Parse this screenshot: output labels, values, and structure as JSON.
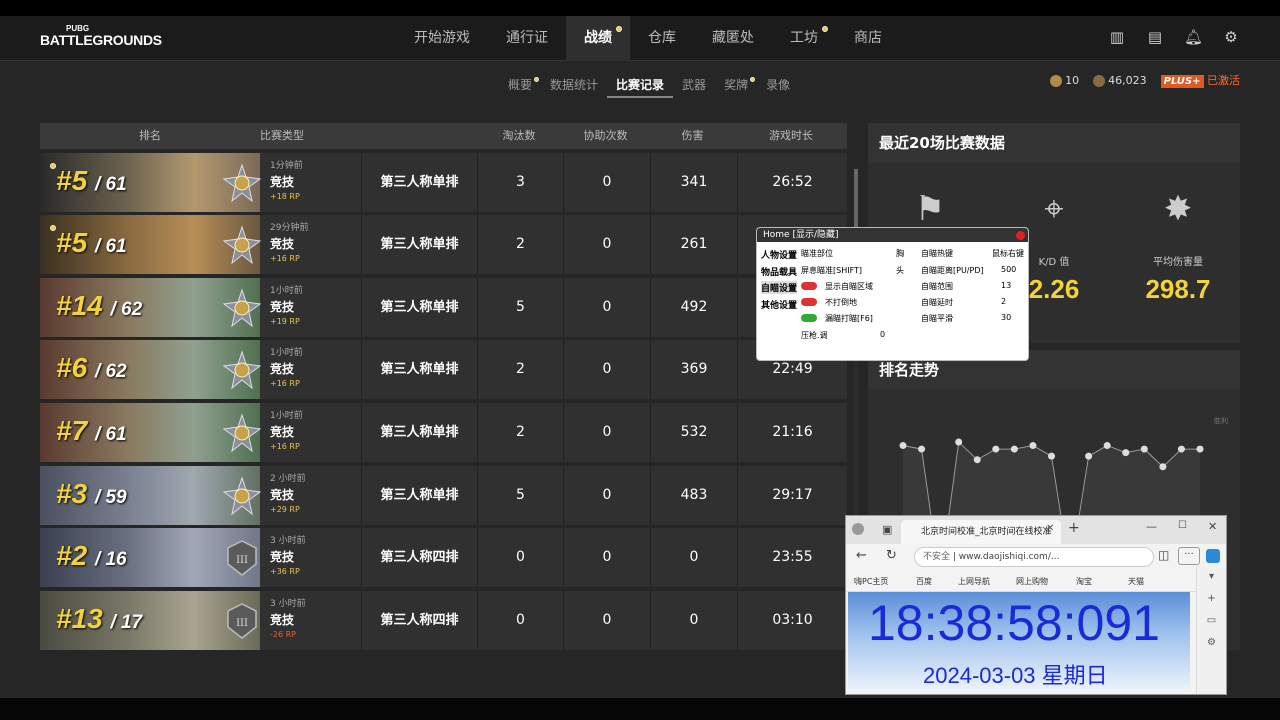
{
  "topbar": {
    "logo_small": "PUBG",
    "logo_big": "BATTLEGROUNDS",
    "nav": [
      {
        "label": "开始游戏",
        "active": false
      },
      {
        "label": "通行证",
        "active": false
      },
      {
        "label": "战绩",
        "active": true
      },
      {
        "label": "仓库",
        "active": false
      },
      {
        "label": "藏匿处",
        "active": false
      },
      {
        "label": "工坊",
        "active": false
      },
      {
        "label": "商店",
        "active": false
      }
    ]
  },
  "subnav": [
    {
      "label": "概要"
    },
    {
      "label": "数据统计"
    },
    {
      "label": "比赛记录"
    },
    {
      "label": "武器"
    },
    {
      "label": "奖牌"
    },
    {
      "label": "录像"
    }
  ],
  "currency": {
    "g_coin": "10",
    "bp": "46,023",
    "plus": "PLUS+",
    "status": "已激活"
  },
  "table": {
    "headers": {
      "rank": "排名",
      "type": "比赛类型",
      "kills": "淘汰数",
      "assists": "协助次数",
      "damage": "伤害",
      "time": "游戏时长"
    },
    "rows": [
      {
        "rank": "#5",
        "total": "/ 61",
        "ago": "1分钟前",
        "mode": "竞技",
        "rp": "+18 RP",
        "type": "第三人称单排",
        "kills": "3",
        "assists": "0",
        "damage": "341",
        "time": "26:52"
      },
      {
        "rank": "#5",
        "total": "/ 61",
        "ago": "29分钟前",
        "mode": "竞技",
        "rp": "+16 RP",
        "type": "第三人称单排",
        "kills": "2",
        "assists": "0",
        "damage": "261",
        "time": ""
      },
      {
        "rank": "#14",
        "total": "/ 62",
        "ago": "1小时前",
        "mode": "竞技",
        "rp": "+19 RP",
        "type": "第三人称单排",
        "kills": "5",
        "assists": "0",
        "damage": "492",
        "time": ""
      },
      {
        "rank": "#6",
        "total": "/ 62",
        "ago": "1小时前",
        "mode": "竞技",
        "rp": "+16 RP",
        "type": "第三人称单排",
        "kills": "2",
        "assists": "0",
        "damage": "369",
        "time": "22:49"
      },
      {
        "rank": "#7",
        "total": "/ 61",
        "ago": "1小时前",
        "mode": "竞技",
        "rp": "+16 RP",
        "type": "第三人称单排",
        "kills": "2",
        "assists": "0",
        "damage": "532",
        "time": "21:16"
      },
      {
        "rank": "#3",
        "total": "/ 59",
        "ago": "2 小时前",
        "mode": "竞技",
        "rp": "+29 RP",
        "type": "第三人称单排",
        "kills": "5",
        "assists": "0",
        "damage": "483",
        "time": "29:17"
      },
      {
        "rank": "#2",
        "total": "/ 16",
        "ago": "3 小时前",
        "mode": "竞技",
        "rp": "+36 RP",
        "type": "第三人称四排",
        "kills": "0",
        "assists": "0",
        "damage": "0",
        "time": "23:55"
      },
      {
        "rank": "#13",
        "total": "/ 17",
        "ago": "3 小时前",
        "mode": "竞技",
        "rp": "-26 RP",
        "type": "第三人称四排",
        "kills": "0",
        "assists": "0",
        "damage": "0",
        "time": "03:10"
      }
    ]
  },
  "stats_panel": {
    "title": "最近20场比赛数据",
    "kd_label": "K/D 值",
    "kd_value": "2.26",
    "dmg_label": "平均伤害量",
    "dmg_value": "298.7"
  },
  "trend_panel": {
    "title": "排名走势",
    "side_label": "胜利"
  },
  "chart_data": {
    "type": "line",
    "title": "排名走势",
    "values": [
      2,
      3,
      40,
      1,
      6,
      3,
      3,
      2,
      5,
      38,
      5,
      2,
      4,
      3,
      8,
      3,
      3
    ]
  },
  "overlay": {
    "title": "Home [显示/隐藏]",
    "col1": [
      "人物设置",
      "物品载具",
      "自瞄设置",
      "其他设置"
    ],
    "col2": [
      "瞄准部位",
      "屏息瞄准[SHIFT]",
      "显示自瞄区域",
      "不打倒地",
      "漏瞄打瞄[F6]",
      "压枪.调"
    ],
    "col2_val": [
      "胸",
      "头",
      "",
      "",
      "",
      "0"
    ],
    "col3": [
      "自瞄热键",
      "自瞄距离[PU/PD]",
      "自瞄范围",
      "自瞄延时",
      "自瞄平滑"
    ],
    "col3_val": [
      "鼠标右键",
      "500",
      "13",
      "2",
      "30"
    ]
  },
  "browser": {
    "tab_title": "北京时间校准_北京时间在线校准",
    "insecure": "不安全",
    "url": "www.daojishiqi.com/...",
    "favorites": [
      "嗨PC主页",
      "百度",
      "上网导航",
      "网上购物",
      "淘宝",
      "天猫"
    ],
    "clock": "18:38:58:091",
    "date": "2024-03-03 星期日"
  }
}
